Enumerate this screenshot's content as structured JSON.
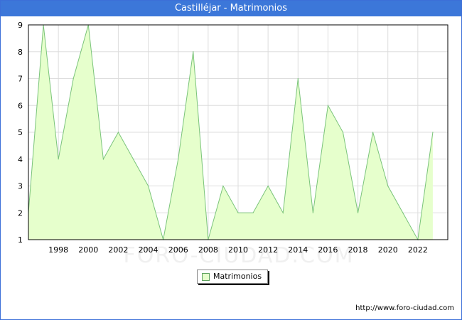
{
  "title": "Castilléjar - Matrimonios",
  "url": "http://www.foro-ciudad.com",
  "watermark": "FORO-CIUDAD.COM",
  "chart_data": {
    "type": "area",
    "x": [
      1996,
      1997,
      1998,
      1999,
      2000,
      2001,
      2002,
      2003,
      2004,
      2005,
      2006,
      2007,
      2008,
      2009,
      2010,
      2011,
      2012,
      2013,
      2014,
      2015,
      2016,
      2017,
      2018,
      2019,
      2020,
      2021,
      2022,
      2023
    ],
    "series": [
      {
        "name": "Matrimonios",
        "values": [
          2,
          9,
          4,
          7,
          9,
          4,
          5,
          4,
          3,
          1,
          4,
          8,
          1,
          3,
          2,
          2,
          3,
          2,
          7,
          2,
          6,
          5,
          2,
          5,
          3,
          2,
          1,
          5
        ],
        "color": "#e6ffcc",
        "line_color": "#7ac47a"
      }
    ],
    "xticks": [
      "1998",
      "2000",
      "2002",
      "2004",
      "2006",
      "2008",
      "2010",
      "2012",
      "2014",
      "2016",
      "2018",
      "2020",
      "2022"
    ],
    "yticks": [
      "1",
      "2",
      "3",
      "4",
      "5",
      "6",
      "7",
      "8",
      "9"
    ],
    "xlim": [
      1996,
      2024
    ],
    "ylim": [
      1,
      9
    ],
    "grid": true,
    "legend_position": "bottom"
  }
}
